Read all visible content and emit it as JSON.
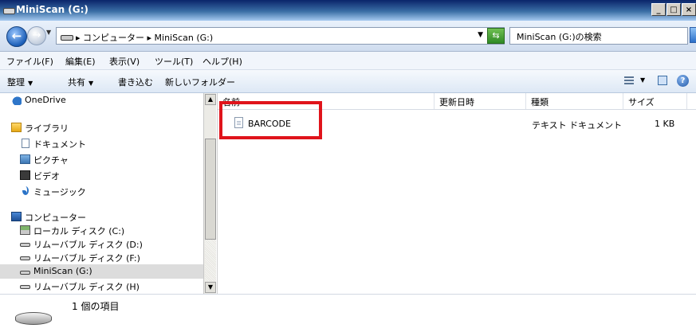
{
  "window": {
    "title": "MiniScan (G:)"
  },
  "window_buttons": [
    "_",
    "□",
    "×"
  ],
  "address": {
    "path": "▸ コンピューター ▸ MiniScan (G:)",
    "search_placeholder": "MiniScan (G:)の検索"
  },
  "menu": [
    "ファイル(F)",
    "編集(E)",
    "表示(V)",
    "ツール(T)",
    "ヘルプ(H)"
  ],
  "toolbar": {
    "organize": "整理",
    "share": "共有",
    "burn": "書き込む",
    "new_folder": "新しいフォルダー"
  },
  "nav": {
    "onedrive": "OneDrive",
    "libraries": "ライブラリ",
    "documents": "ドキュメント",
    "pictures": "ピクチャ",
    "videos": "ビデオ",
    "music": "ミュージック",
    "computer": "コンピューター",
    "local_disk": "ローカル ディスク (C:)",
    "removable_d": "リムーバブル ディスク (D:)",
    "removable_f": "リムーバブル ディスク (F:)",
    "miniscan": "MiniScan (G:)",
    "removable_h": "リムーバブル ディスク (H)"
  },
  "columns": {
    "name": "名前",
    "modified": "更新日時",
    "type": "種類",
    "size": "サイズ"
  },
  "files": [
    {
      "name": "BARCODE",
      "modified": "",
      "type": "テキスト ドキュメント",
      "size": "1 KB"
    }
  ],
  "status": {
    "count": "1 個の項目"
  },
  "colors": {
    "highlight": "#e0141b",
    "selection": "#dcdcdc"
  }
}
